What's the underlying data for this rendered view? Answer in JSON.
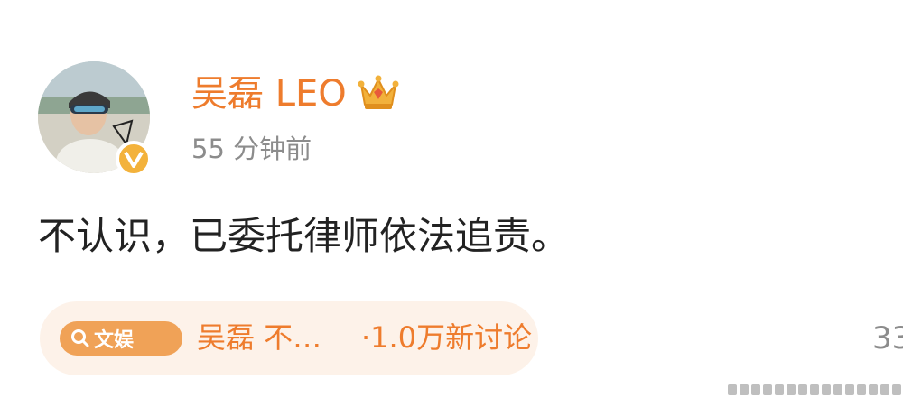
{
  "post": {
    "username": "吴磊 LEO",
    "timestamp": "55 分钟前",
    "text": "不认识，已委托律师依法追责。"
  },
  "topic": {
    "tag_label": "文娱",
    "title": "吴磊 不…",
    "meta": "·1.0万新讨论"
  },
  "side": {
    "count_partial": "33"
  },
  "colors": {
    "accent": "#ee7c2d",
    "chip_bg": "#fdf2e9",
    "tag_bg": "#f0a257",
    "badge": "#f3b23b",
    "muted": "#8c8c8c"
  },
  "icons": {
    "verified": "verified-v-icon",
    "crown": "crown-icon",
    "search": "search-icon"
  }
}
